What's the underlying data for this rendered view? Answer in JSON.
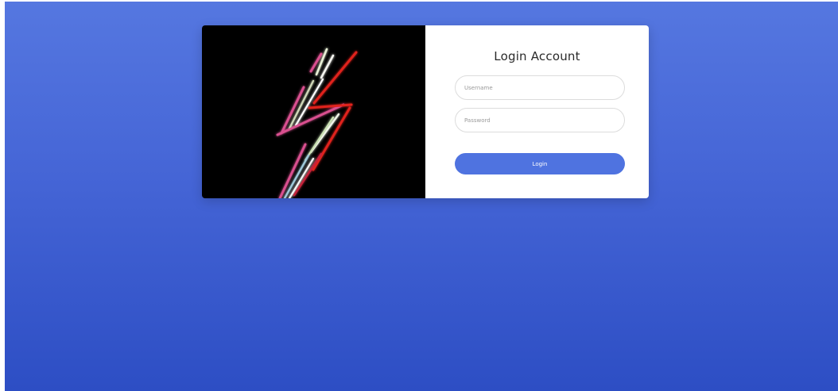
{
  "login": {
    "title": "Login Account",
    "username_placeholder": "Username",
    "password_placeholder": "Password",
    "login_label": "Login"
  },
  "colors": {
    "background_top": "#5577e0",
    "background_bottom": "#2d4ec4",
    "button": "#4f73e0",
    "art_background": "#000000"
  },
  "icons": {
    "hero_art": "neon-lightning-bolt"
  }
}
